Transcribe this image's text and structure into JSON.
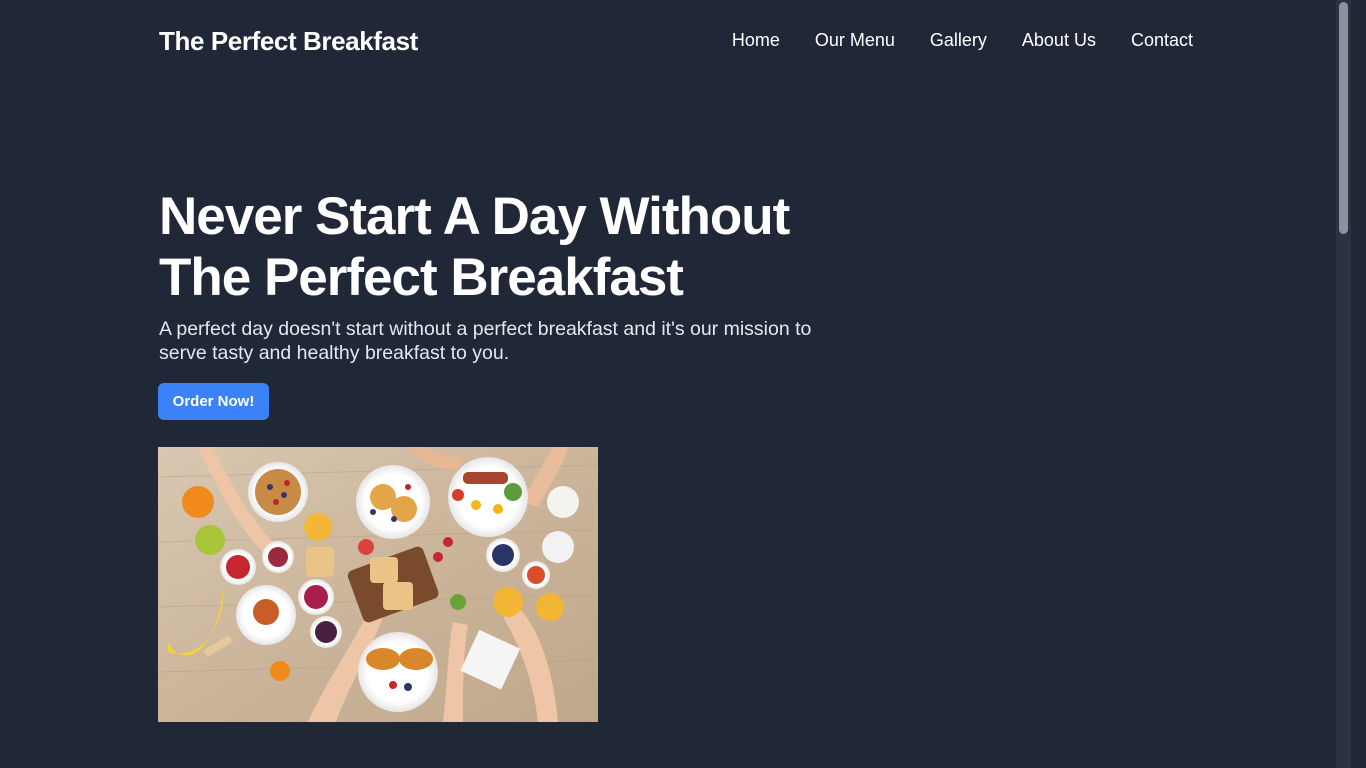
{
  "header": {
    "brand": "The Perfect Breakfast",
    "nav": [
      "Home",
      "Our Menu",
      "Gallery",
      "About Us",
      "Contact"
    ]
  },
  "hero": {
    "title_line1": "Never Start A Day Without",
    "title_line2": "The Perfect Breakfast",
    "subtitle": "A perfect day doesn't start without a perfect breakfast and it's our mission to serve tasty and healthy breakfast to you.",
    "cta_label": "Order Now!"
  },
  "colors": {
    "background": "#202837",
    "accent": "#3b82f6",
    "text": "#ffffff"
  }
}
